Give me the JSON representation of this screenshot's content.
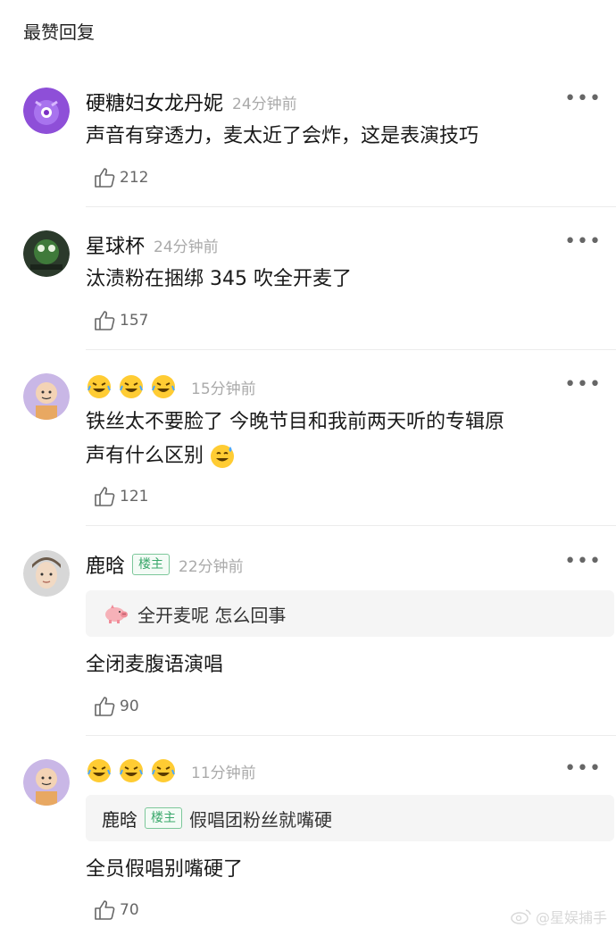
{
  "section_title": "最赞回复",
  "more_icon_text": "•••",
  "comments": [
    {
      "name": "硬糖妇女龙丹妮",
      "time": "24分钟前",
      "text": "声音有穿透力，麦太近了会炸，这是表演技巧",
      "likes": "212"
    },
    {
      "name": "星球杯",
      "time": "24分钟前",
      "text": "汰渍粉在捆绑 345 吹全开麦了",
      "likes": "157"
    },
    {
      "name_emojis": [
        "rolling-laugh-emoji",
        "rolling-laugh-emoji",
        "rolling-laugh-emoji"
      ],
      "time": "15分钟前",
      "text_line1": "铁丝太不要脸了 今晚节目和我前两天听的专辑原",
      "text_line2": "声有什么区别",
      "likes": "121"
    },
    {
      "name": "鹿晗",
      "badge": "楼主",
      "time": "22分钟前",
      "quote_text": "全开麦呢 怎么回事",
      "text": "全闭麦腹语演唱",
      "likes": "90"
    },
    {
      "name_emojis": [
        "rolling-laugh-emoji",
        "rolling-laugh-emoji",
        "rolling-laugh-emoji"
      ],
      "time": "11分钟前",
      "quote_name": "鹿晗",
      "quote_badge": "楼主",
      "quote_text": "假唱团粉丝就嘴硬",
      "text": "全员假唱别嘴硬了",
      "likes": "70"
    }
  ],
  "watermark": "@星娱捕手",
  "colors": {
    "badge_green": "#3aa86b",
    "time_gray": "#aaaaaa",
    "divider": "#ececec"
  }
}
